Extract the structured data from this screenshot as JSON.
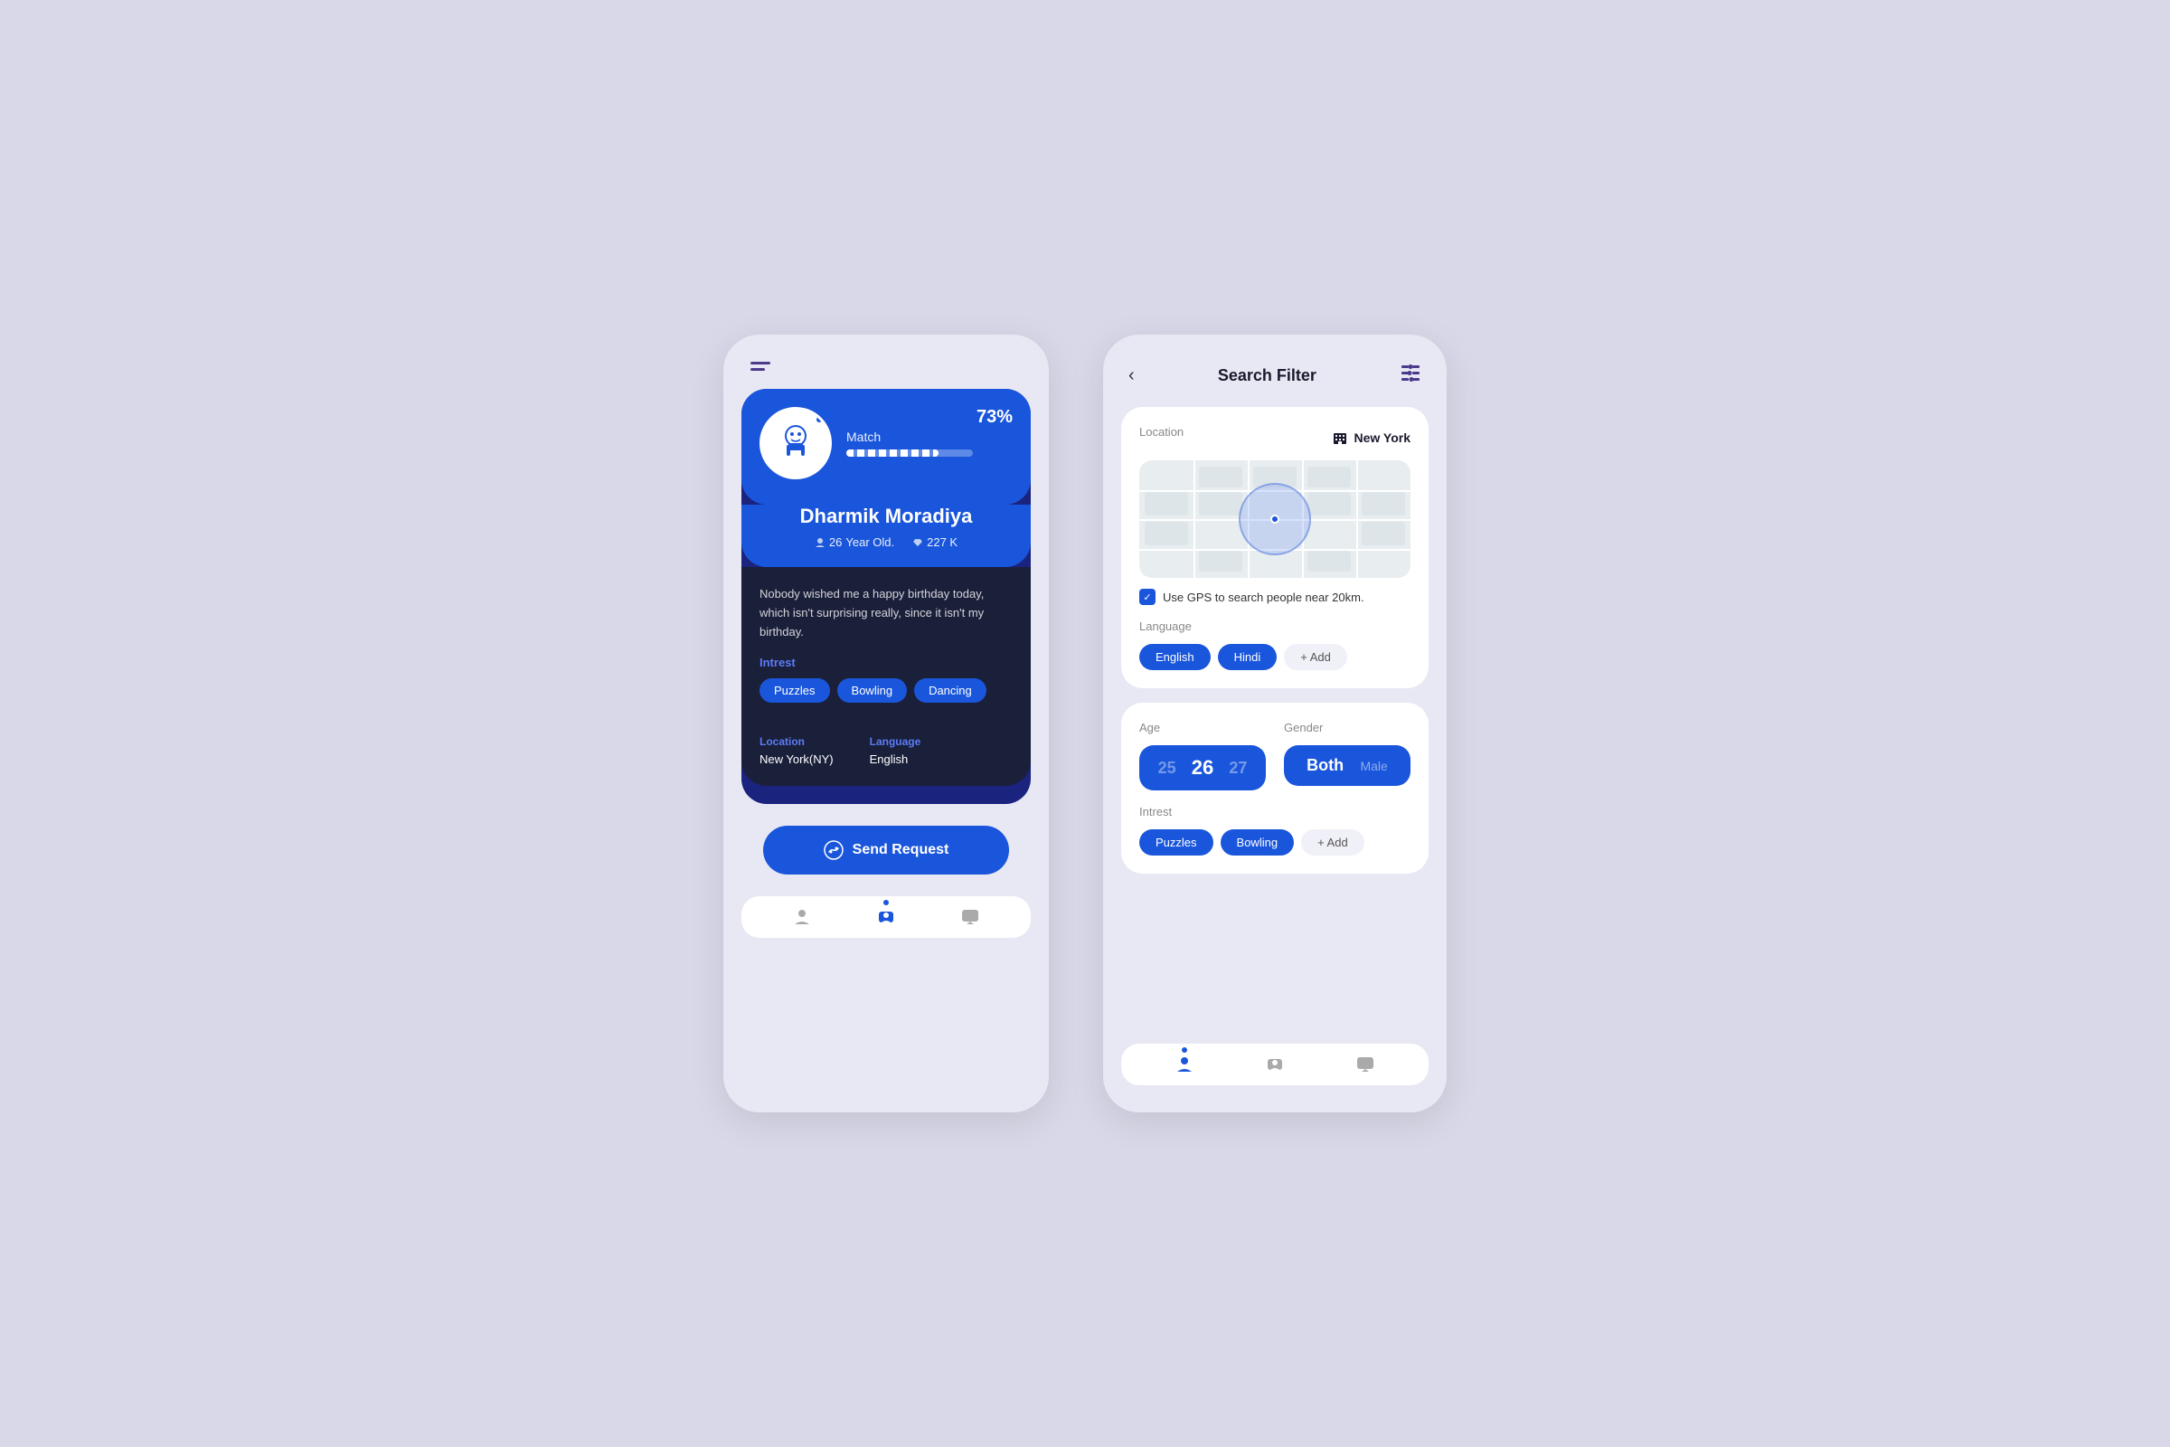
{
  "app": {
    "background": "#d8d8e8"
  },
  "phone1": {
    "menu_icon": "menu",
    "profile": {
      "match_label": "Match",
      "match_percent": "73%",
      "match_bar_width": "73%",
      "name": "Dharmik Moradiya",
      "age": "26",
      "age_label": "Year Old.",
      "likes": "227 K",
      "bio": "Nobody wished me a happy birthday today, which isn't surprising really, since it isn't my birthday.",
      "interest_label": "Intrest",
      "interests": [
        "Puzzles",
        "Bowling",
        "Dancing"
      ],
      "location_label": "Location",
      "location_value": "New York(NY)",
      "language_label": "Language",
      "language_value": "English"
    },
    "send_request_btn": "Send Request",
    "bottom_nav": {
      "items": [
        "person",
        "id-card",
        "chat"
      ]
    }
  },
  "phone2": {
    "header": {
      "back": "<",
      "title": "Search Filter",
      "settings": "⚙"
    },
    "location_section": {
      "label": "Location",
      "city": "New York",
      "gps_label": "Use GPS to search people near 20km."
    },
    "language_section": {
      "label": "Language",
      "tags": [
        "English",
        "Hindi"
      ],
      "add_label": "+ Add"
    },
    "age_section": {
      "label": "Age",
      "values": [
        "25",
        "26",
        "27"
      ],
      "active": "26"
    },
    "gender_section": {
      "label": "Gender",
      "options": [
        "Both",
        "Male"
      ],
      "selected": "Both"
    },
    "intrest_section": {
      "label": "Intrest",
      "tags": [
        "Puzzles",
        "Bowling"
      ],
      "add_label": "+ Add"
    },
    "bottom_nav": {
      "items": [
        "person",
        "id-card",
        "chat"
      ]
    }
  }
}
